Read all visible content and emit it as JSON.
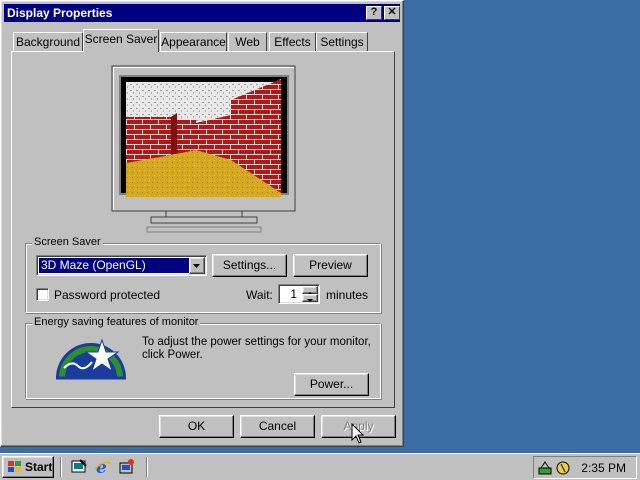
{
  "window": {
    "title": "Display Properties",
    "help_glyph": "?",
    "close_glyph": "✕"
  },
  "tabs": [
    {
      "label": "Background"
    },
    {
      "label": "Screen Saver"
    },
    {
      "label": "Appearance"
    },
    {
      "label": "Web"
    },
    {
      "label": "Effects"
    },
    {
      "label": "Settings"
    }
  ],
  "screen_saver": {
    "group_label": "Screen Saver",
    "selected": "3D Maze (OpenGL)",
    "settings_button": "Settings...",
    "preview_button": "Preview",
    "password_label": "Password protected",
    "password_checked": false,
    "wait_label": "Wait:",
    "wait_value": "1",
    "minutes_label": "minutes"
  },
  "energy": {
    "group_label": "Energy saving features of monitor",
    "description": "To adjust the power settings for your monitor, click Power.",
    "power_button": "Power..."
  },
  "dialog_buttons": {
    "ok": "OK",
    "cancel": "Cancel",
    "apply": "Apply"
  },
  "taskbar": {
    "start_label": "Start",
    "clock": "2:35 PM"
  },
  "colors": {
    "desktop": "#3a6ea5",
    "title_bar": "#000080",
    "face": "#c0c0c0",
    "selection": "#000080"
  },
  "icons": [
    "help-icon",
    "close-icon",
    "monitor-preview",
    "energy-star-logo",
    "windows-flag-icon",
    "desktop-icon",
    "internet-explorer-icon",
    "channels-icon",
    "network-tray-icon",
    "volume-tray-icon",
    "mouse-cursor"
  ]
}
